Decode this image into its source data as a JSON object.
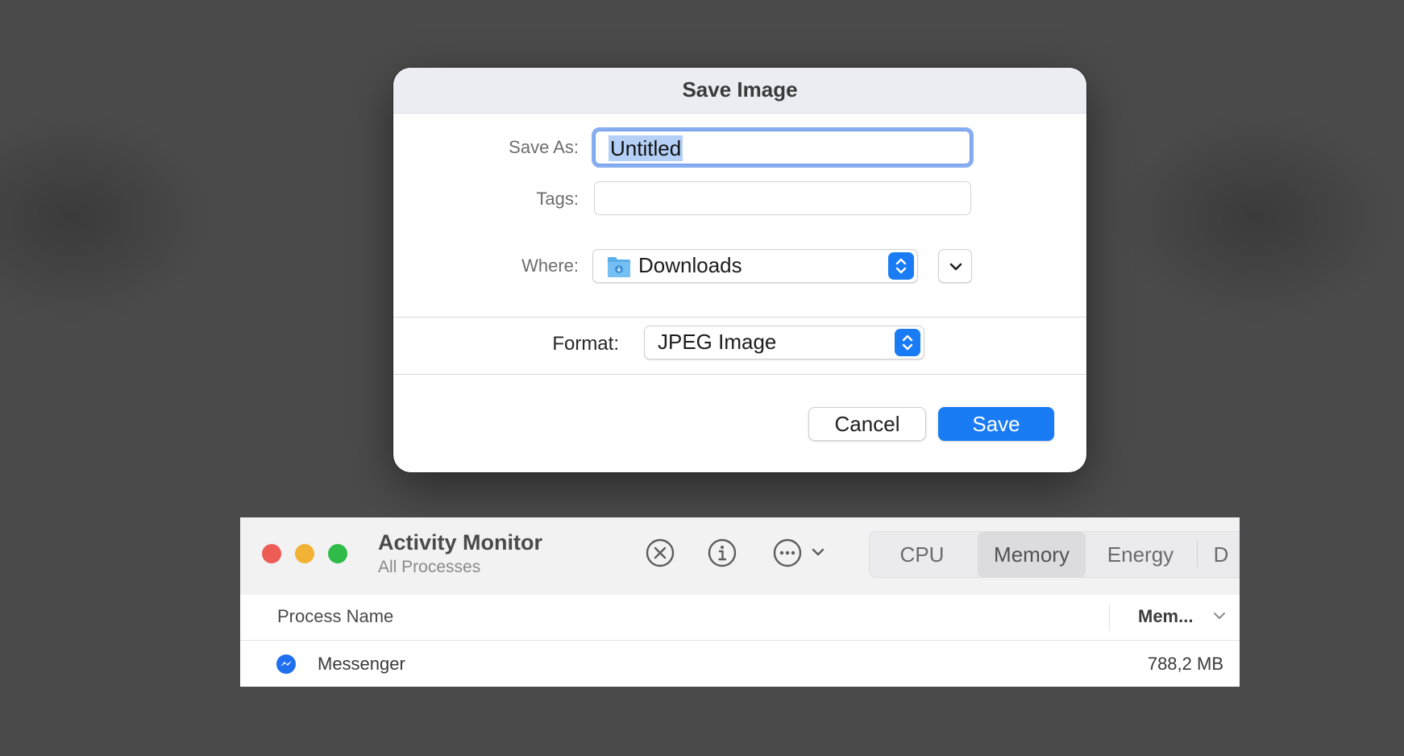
{
  "dialog": {
    "title": "Save Image",
    "save_as_label": "Save As:",
    "save_as_value": "Untitled",
    "tags_label": "Tags:",
    "tags_value": "",
    "where_label": "Where:",
    "where_value": "Downloads",
    "format_label": "Format:",
    "format_value": "JPEG Image",
    "cancel_label": "Cancel",
    "save_label": "Save"
  },
  "activity_monitor": {
    "title": "Activity Monitor",
    "subtitle": "All Processes",
    "tabs": [
      "CPU",
      "Memory",
      "Energy",
      "D"
    ],
    "active_tab": "Memory",
    "columns": {
      "process_name": "Process Name",
      "memory": "Mem..."
    },
    "rows": [
      {
        "name": "Messenger",
        "memory": "788,2 MB",
        "icon": "messenger-icon"
      }
    ],
    "toolbar_icons": [
      "stop-process-icon",
      "info-icon",
      "more-options-icon",
      "chevron-down-icon"
    ]
  },
  "colors": {
    "accent_blue": "#1a7cf5",
    "traffic_red": "#ee5d55",
    "traffic_yellow": "#f1b235",
    "traffic_green": "#2fbb48",
    "background": "#4b4b4b"
  }
}
